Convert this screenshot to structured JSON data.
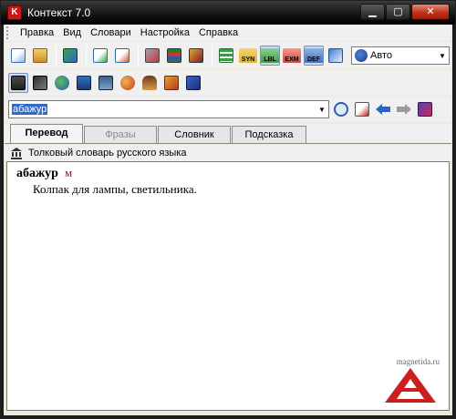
{
  "window": {
    "title": "Контекст 7.0",
    "close": "✕",
    "minimize": "▁",
    "maximize": "▢"
  },
  "menu": {
    "items": [
      "Правка",
      "Вид",
      "Словари",
      "Настройка",
      "Справка"
    ]
  },
  "toolbar1": {
    "buttons": [
      "copy",
      "paste",
      "swap-direction",
      "add-entry",
      "edit-entry",
      "tools",
      "dictionaries",
      "dict-edit"
    ],
    "labels": {
      "syn": "SYN",
      "lbl": "LBL",
      "exm": "EXM",
      "def": "DEF"
    },
    "mode_select": {
      "value": "Авто",
      "arrow": "▼"
    }
  },
  "toolbar2": {
    "buttons": [
      "dictionary",
      "phonetics",
      "globe",
      "book-stack",
      "server",
      "users",
      "person",
      "letters",
      "blue-book"
    ]
  },
  "search": {
    "value": "абажур",
    "arrow": "▼"
  },
  "tabs": [
    {
      "label": "Перевод",
      "state": "active"
    },
    {
      "label": "Фразы",
      "state": "disabled"
    },
    {
      "label": "Словник",
      "state": "normal"
    },
    {
      "label": "Подсказка",
      "state": "normal"
    }
  ],
  "dictionary": {
    "name": "Толковый словарь русского языка"
  },
  "entry": {
    "headword": "абажур",
    "pos": "м",
    "definition": "Колпак для лампы, светильника."
  },
  "watermark": {
    "text": "magnetida.ru"
  },
  "colors": {
    "titlebar": "#121212",
    "accent": "#3169c6",
    "pos": "#8b1a1a",
    "watermark_red": "#cc1f1f"
  }
}
